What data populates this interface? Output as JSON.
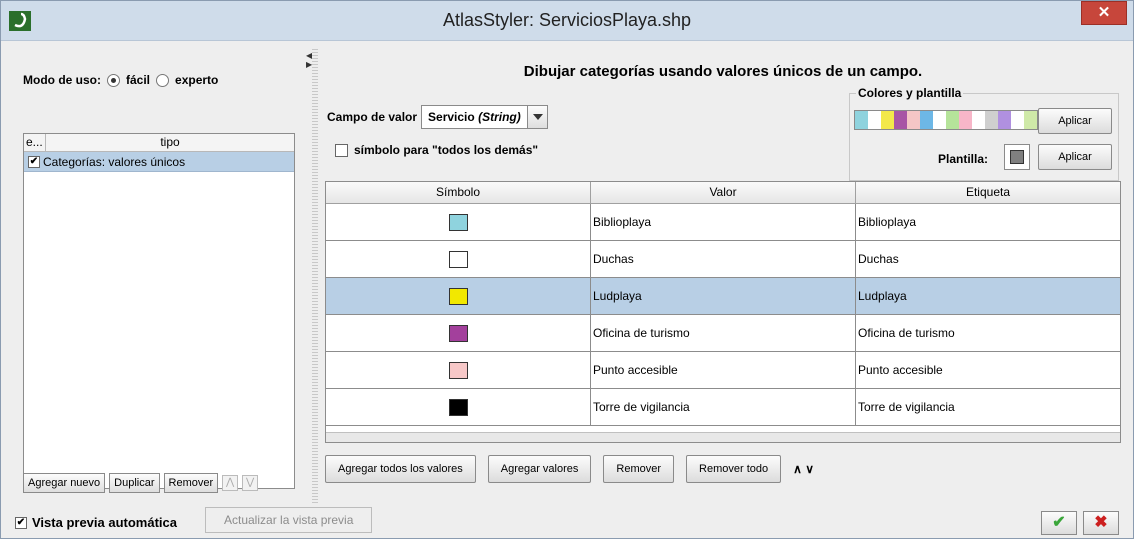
{
  "window": {
    "title": "AtlasStyler: ServiciosPlaya.shp",
    "close_glyph": "✕"
  },
  "left": {
    "mode_label": "Modo de uso:",
    "mode_easy": "fácil",
    "mode_expert": "experto",
    "mode_selected": "fácil",
    "rule_table": {
      "col_enabled": "e...",
      "col_type": "tipo",
      "rows": [
        {
          "checked": true,
          "label": "Categorías: valores únicos"
        }
      ]
    },
    "buttons": {
      "add_new": "Agregar nuevo",
      "duplicate": "Duplicar",
      "remove": "Remover",
      "up": "⋀",
      "down": "⋁"
    }
  },
  "right": {
    "heading": "Dibujar categorías usando valores únicos de un campo.",
    "campo_label": "Campo de valor",
    "campo_value": "Servicio",
    "campo_type": "(String)",
    "todos_label": "símbolo para \"todos los demás\"",
    "colores": {
      "legend": "Colores y plantilla",
      "palette": [
        "#8fd3de",
        "#ffffff",
        "#f2e84a",
        "#a855a5",
        "#f5c6c6",
        "#6db7e6",
        "#ffffff",
        "#b5e39a",
        "#f7b6c8",
        "#ffffff",
        "#cfcfcf",
        "#b090e0",
        "#ffffff",
        "#cfe9a8",
        "#fff",
        "#f6e67a"
      ],
      "aplicar": "Aplicar",
      "plantilla_label": "Plantilla:",
      "plantilla_color": "#808080"
    },
    "table": {
      "headers": [
        "Símbolo",
        "Valor",
        "Etiqueta"
      ],
      "rows": [
        {
          "color": "#8fd3de",
          "valor": "Biblioplaya",
          "etiqueta": "Biblioplaya"
        },
        {
          "color": "#ffffff",
          "valor": "Duchas",
          "etiqueta": "Duchas"
        },
        {
          "color": "#f2e800",
          "valor": "Ludplaya",
          "etiqueta": "Ludplaya",
          "selected": true
        },
        {
          "color": "#a3409c",
          "valor": "Oficina de turismo",
          "etiqueta": "Oficina de turismo"
        },
        {
          "color": "#f7c8c8",
          "valor": "Punto accesible",
          "etiqueta": "Punto accesible"
        },
        {
          "color": "#000000",
          "valor": "Torre de vigilancia",
          "etiqueta": "Torre de vigilancia"
        }
      ]
    },
    "buttons": {
      "add_all": "Agregar todos los valores",
      "add_values": "Agregar valores",
      "remove": "Remover",
      "remove_all": "Remover todo",
      "up": "∧",
      "down": "∨"
    }
  },
  "status": {
    "auto_preview": "Vista previa automática",
    "update_preview": "Actualizar la vista previa",
    "ok_glyph": "✔",
    "cancel_glyph": "✖"
  }
}
